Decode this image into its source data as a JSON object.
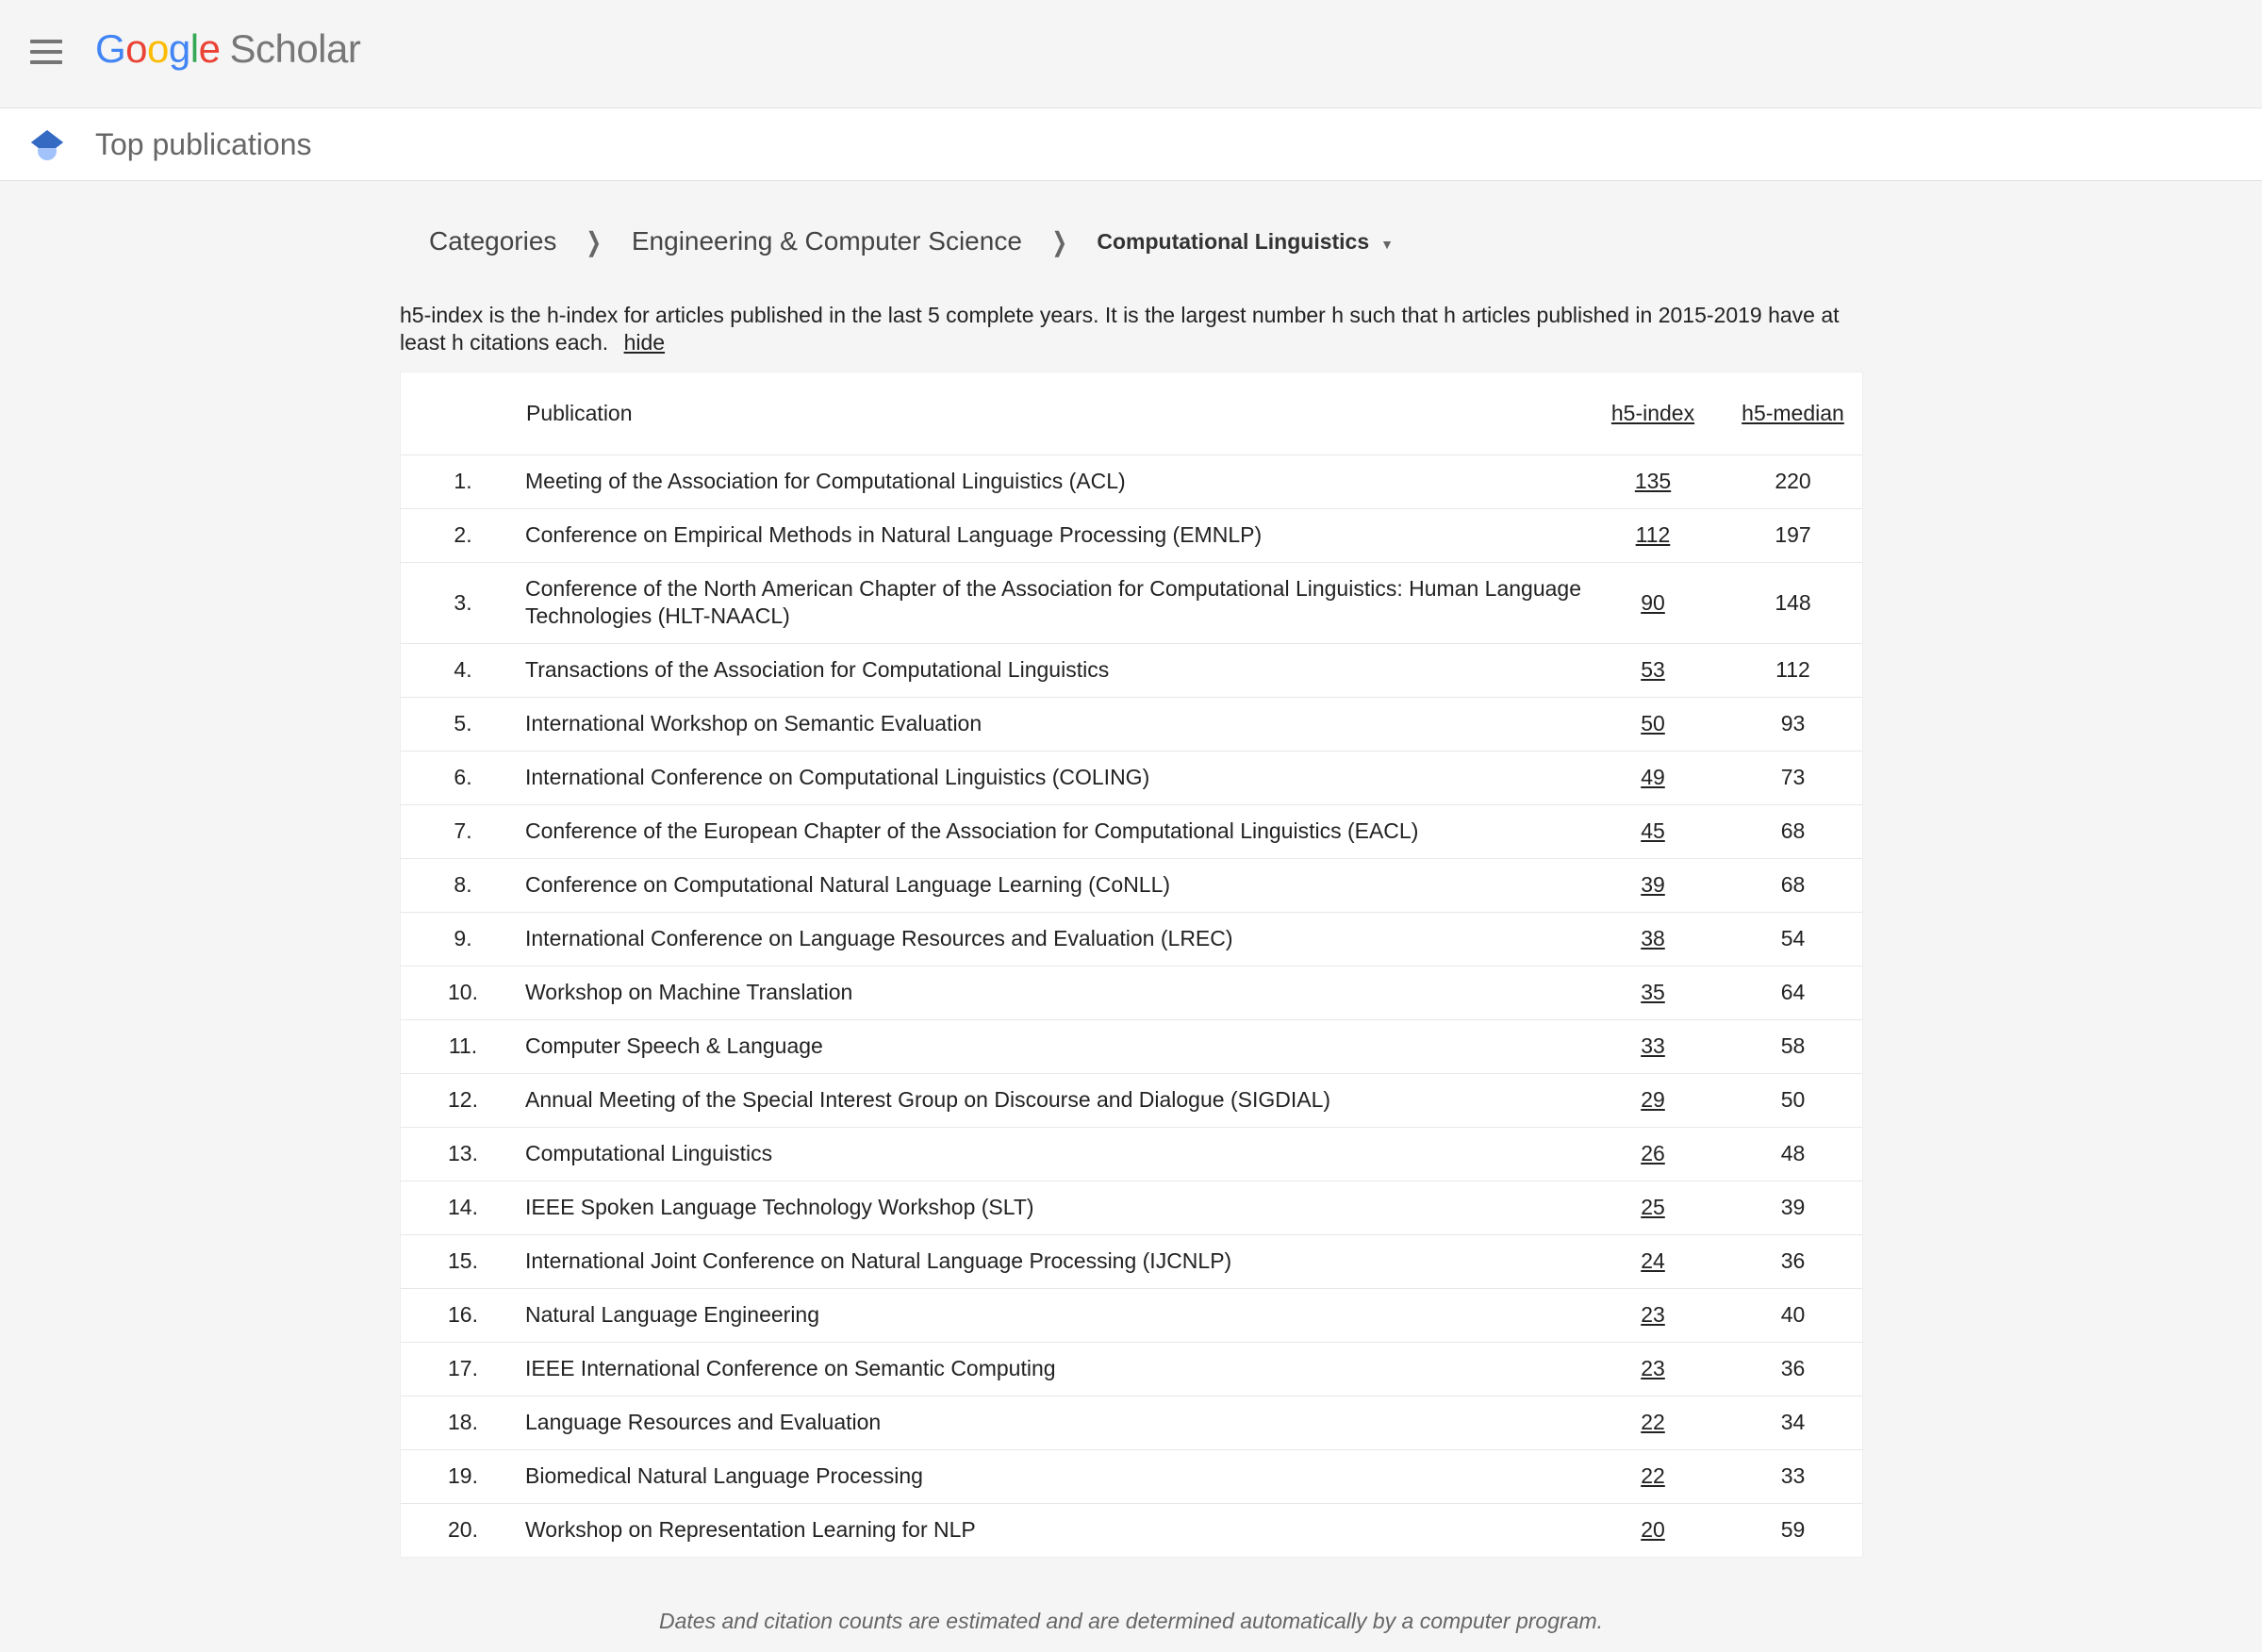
{
  "header": {
    "logo_google": "Google",
    "logo_scholar": "Scholar",
    "subtitle": "Top publications"
  },
  "breadcrumb": {
    "categories": "Categories",
    "parent": "Engineering & Computer Science",
    "current": "Computational Linguistics"
  },
  "note": {
    "text": "h5-index is the h-index for articles published in the last 5 complete years. It is the largest number h such that h articles published in 2015-2019 have at least h citations each.",
    "hide_link": "hide"
  },
  "table": {
    "headers": {
      "rank": "",
      "publication": "Publication",
      "h5_index": "h5-index",
      "h5_median": "h5-median"
    },
    "rows": [
      {
        "rank": "1.",
        "name": "Meeting of the Association for Computational Linguistics (ACL)",
        "h5": "135",
        "median": "220"
      },
      {
        "rank": "2.",
        "name": "Conference on Empirical Methods in Natural Language Processing (EMNLP)",
        "h5": "112",
        "median": "197"
      },
      {
        "rank": "3.",
        "name": "Conference of the North American Chapter of the Association for Computational Linguistics: Human Language Technologies (HLT-NAACL)",
        "h5": "90",
        "median": "148"
      },
      {
        "rank": "4.",
        "name": "Transactions of the Association for Computational Linguistics",
        "h5": "53",
        "median": "112"
      },
      {
        "rank": "5.",
        "name": "International Workshop on Semantic Evaluation",
        "h5": "50",
        "median": "93"
      },
      {
        "rank": "6.",
        "name": "International Conference on Computational Linguistics (COLING)",
        "h5": "49",
        "median": "73"
      },
      {
        "rank": "7.",
        "name": "Conference of the European Chapter of the Association for Computational Linguistics (EACL)",
        "h5": "45",
        "median": "68"
      },
      {
        "rank": "8.",
        "name": "Conference on Computational Natural Language Learning (CoNLL)",
        "h5": "39",
        "median": "68"
      },
      {
        "rank": "9.",
        "name": "International Conference on Language Resources and Evaluation (LREC)",
        "h5": "38",
        "median": "54"
      },
      {
        "rank": "10.",
        "name": "Workshop on Machine Translation",
        "h5": "35",
        "median": "64"
      },
      {
        "rank": "11.",
        "name": "Computer Speech & Language",
        "h5": "33",
        "median": "58"
      },
      {
        "rank": "12.",
        "name": "Annual Meeting of the Special Interest Group on Discourse and Dialogue (SIGDIAL)",
        "h5": "29",
        "median": "50"
      },
      {
        "rank": "13.",
        "name": "Computational Linguistics",
        "h5": "26",
        "median": "48"
      },
      {
        "rank": "14.",
        "name": "IEEE Spoken Language Technology Workshop (SLT)",
        "h5": "25",
        "median": "39"
      },
      {
        "rank": "15.",
        "name": "International Joint Conference on Natural Language Processing (IJCNLP)",
        "h5": "24",
        "median": "36"
      },
      {
        "rank": "16.",
        "name": "Natural Language Engineering",
        "h5": "23",
        "median": "40"
      },
      {
        "rank": "17.",
        "name": "IEEE International Conference on Semantic Computing",
        "h5": "23",
        "median": "36"
      },
      {
        "rank": "18.",
        "name": "Language Resources and Evaluation",
        "h5": "22",
        "median": "34"
      },
      {
        "rank": "19.",
        "name": "Biomedical Natural Language Processing",
        "h5": "22",
        "median": "33"
      },
      {
        "rank": "20.",
        "name": "Workshop on Representation Learning for NLP",
        "h5": "20",
        "median": "59"
      }
    ]
  },
  "footer": "Dates and citation counts are estimated and are determined automatically by a computer program."
}
